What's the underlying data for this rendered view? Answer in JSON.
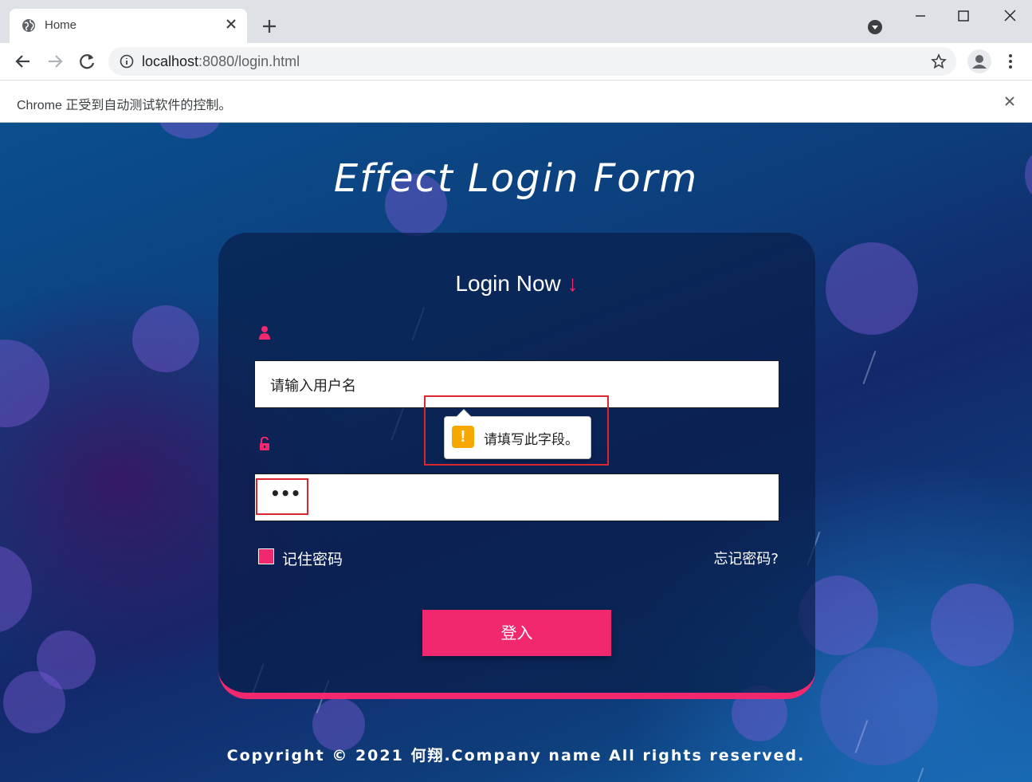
{
  "browser": {
    "tab": {
      "title": "Home"
    },
    "address_bar": {
      "url_host": "localhost",
      "url_rest": ":8080/login.html"
    },
    "infobar": {
      "text": "Chrome 正受到自动测试软件的控制。"
    }
  },
  "page": {
    "hero_title": "Effect Login Form",
    "card": {
      "title": "Login Now",
      "title_arrow": "↓",
      "username": {
        "placeholder": "请输入用户名",
        "value": ""
      },
      "password": {
        "masked_value": "•••"
      },
      "validation_tooltip": {
        "icon": "!",
        "text": "请填写此字段。"
      },
      "remember_label": "记住密码",
      "forgot_link": "忘记密码?",
      "login_button": "登入"
    },
    "footer": "Copyright © 2021 何翔.Company name All rights reserved."
  },
  "colors": {
    "accent": "#f2286f",
    "tooltip_warning": "#f7a800",
    "highlight_box": "#d9262f"
  },
  "icons": {
    "tab": "globe-icon",
    "username": "user-icon",
    "password": "unlock-icon"
  }
}
